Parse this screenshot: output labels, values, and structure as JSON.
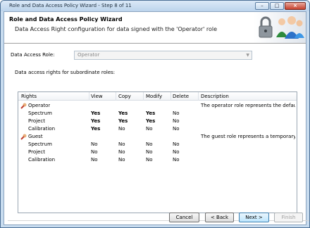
{
  "window": {
    "title": "Role and Data Access Policy Wizard - Step 8 of 11"
  },
  "banner": {
    "heading": "Role and Data Access Policy Wizard",
    "subheading": "Data Access Right configuration for data signed with the 'Operator' role"
  },
  "form": {
    "data_access_role_label": "Data Access Role:",
    "data_access_role_value": "Operator",
    "subordinate_label": "Data access rights for subordinate roles:"
  },
  "table": {
    "columns": [
      "Rights",
      "View",
      "Copy",
      "Modify",
      "Delete",
      "Description"
    ],
    "groups": [
      {
        "name": "Operator",
        "description": "The operator role represents the default l...",
        "rows": [
          {
            "name": "Spectrum",
            "view": "Yes",
            "copy": "Yes",
            "modify": "Yes",
            "delete": "No"
          },
          {
            "name": "Project",
            "view": "Yes",
            "copy": "Yes",
            "modify": "Yes",
            "delete": "No"
          },
          {
            "name": "Calibration",
            "view": "Yes",
            "copy": "No",
            "modify": "No",
            "delete": "No"
          }
        ]
      },
      {
        "name": "Guest",
        "description": "The guest role represents a temporary us...",
        "rows": [
          {
            "name": "Spectrum",
            "view": "No",
            "copy": "No",
            "modify": "No",
            "delete": "No"
          },
          {
            "name": "Project",
            "view": "No",
            "copy": "No",
            "modify": "No",
            "delete": "No"
          },
          {
            "name": "Calibration",
            "view": "No",
            "copy": "No",
            "modify": "No",
            "delete": "No"
          }
        ]
      }
    ]
  },
  "buttons": {
    "cancel": "Cancel",
    "back": "< Back",
    "next": "Next >",
    "finish": "Finish"
  },
  "icons": {
    "role": "key-user-icon",
    "banner": "lock-users-icon"
  },
  "colors": {
    "titlebar": "#bcd4ec",
    "primary_button": "#bee6fd"
  }
}
